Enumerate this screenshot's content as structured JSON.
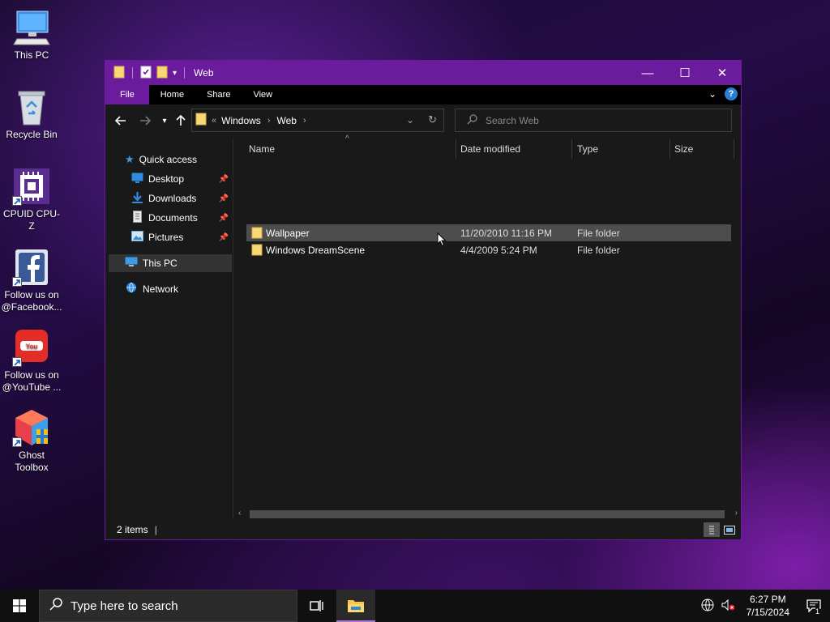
{
  "desktop": {
    "icons": [
      {
        "label": "This PC"
      },
      {
        "label": "Recycle Bin"
      },
      {
        "label": "CPUID CPU-Z"
      },
      {
        "label_line1": "Follow us on",
        "label_line2": "@Facebook..."
      },
      {
        "label_line1": "Follow us on",
        "label_line2": "@YouTube ..."
      },
      {
        "label_line1": "Ghost",
        "label_line2": "Toolbox"
      }
    ]
  },
  "window": {
    "title": "Web",
    "accent_color": "#6b1c9c",
    "controls": {
      "minimize": "—",
      "maximize": "☐",
      "close": "✕"
    }
  },
  "ribbon": {
    "tabs": [
      "File",
      "Home",
      "Share",
      "View"
    ],
    "help": "?"
  },
  "address": {
    "overflow": "«",
    "crumbs": [
      "Windows",
      "Web"
    ]
  },
  "search": {
    "placeholder": "Search Web"
  },
  "nav_pane": {
    "quick_access": "Quick access",
    "items": [
      "Desktop",
      "Downloads",
      "Documents",
      "Pictures"
    ],
    "this_pc": "This PC",
    "network": "Network"
  },
  "columns": [
    "Name",
    "Date modified",
    "Type",
    "Size"
  ],
  "files": [
    {
      "name": "Wallpaper",
      "date": "11/20/2010 11:16 PM",
      "type": "File folder",
      "size": ""
    },
    {
      "name": "Windows DreamScene",
      "date": "4/4/2009 5:24 PM",
      "type": "File folder",
      "size": ""
    }
  ],
  "status": {
    "count": "2 items"
  },
  "taskbar": {
    "search_placeholder": "Type here to search",
    "time": "6:27 PM",
    "date": "7/15/2024",
    "notification_count": "1"
  }
}
